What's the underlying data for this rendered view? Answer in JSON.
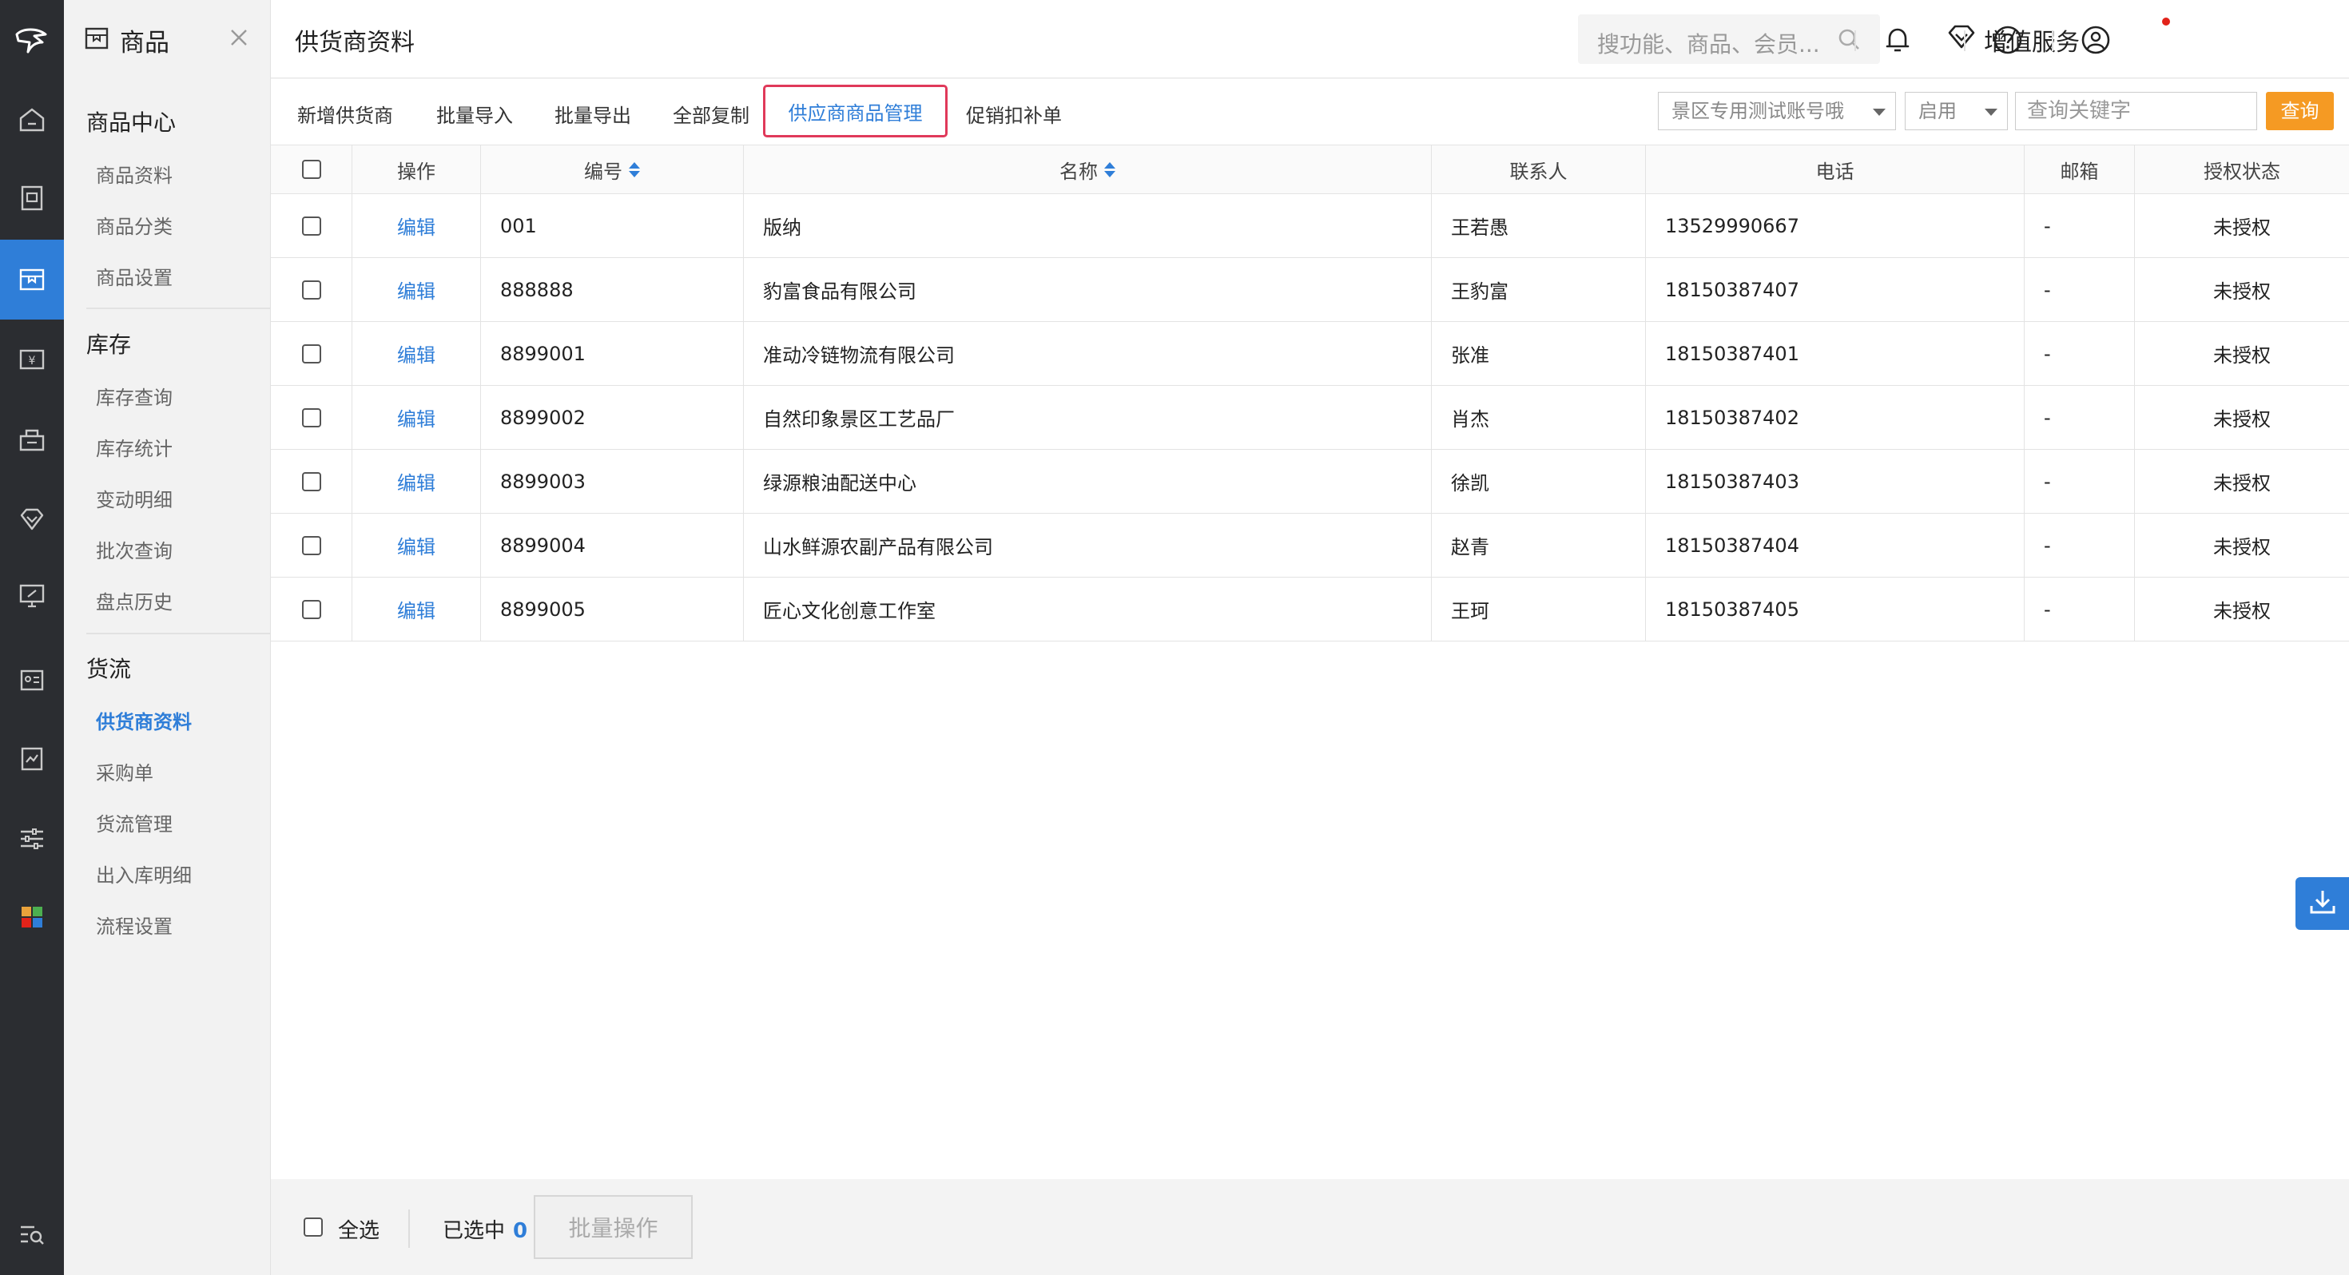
{
  "sidebar": {
    "module_title": "商品",
    "sections": [
      {
        "title": "商品中心",
        "items": [
          "商品资料",
          "商品分类",
          "商品设置"
        ]
      },
      {
        "title": "库存",
        "items": [
          "库存查询",
          "库存统计",
          "变动明细",
          "批次查询",
          "盘点历史"
        ]
      },
      {
        "title": "货流",
        "items": [
          "供货商资料",
          "采购单",
          "货流管理",
          "出入库明细",
          "流程设置"
        ]
      }
    ],
    "active_item": "供货商资料"
  },
  "rail": {
    "icons": [
      "logo-icon",
      "home-icon",
      "goods-list-icon",
      "goods-icon",
      "cashier-icon",
      "member-icon",
      "vip-icon",
      "promotion-icon",
      "staff-icon",
      "report-icon",
      "settings-icon",
      "apps-icon",
      "search-menu-icon"
    ],
    "active": "goods-icon"
  },
  "header": {
    "title": "供货商资料",
    "search_placeholder": "搜功能、商品、会员...",
    "value_added": "增值服务"
  },
  "toolbar": {
    "buttons": [
      "新增供货商",
      "批量导入",
      "批量导出",
      "全部复制",
      "供应商商品管理",
      "促销扣补单"
    ],
    "highlighted": "供应商商品管理",
    "store_select": "景区专用测试账号哦",
    "status_select": "启用",
    "keyword_placeholder": "查询关键字",
    "query_label": "查询"
  },
  "table": {
    "columns": [
      "",
      "操作",
      "编号",
      "名称",
      "联系人",
      "电话",
      "邮箱",
      "授权状态"
    ],
    "edit_label": "编辑",
    "rows": [
      {
        "code": "001",
        "name": "版纳",
        "contact": "王若愚",
        "phone": "13529990667",
        "email": "-",
        "status": "未授权"
      },
      {
        "code": "888888",
        "name": "豹富食品有限公司",
        "contact": "王豹富",
        "phone": "18150387407",
        "email": "-",
        "status": "未授权"
      },
      {
        "code": "8899001",
        "name": "准动冷链物流有限公司",
        "contact": "张准",
        "phone": "18150387401",
        "email": "-",
        "status": "未授权"
      },
      {
        "code": "8899002",
        "name": "自然印象景区工艺品厂",
        "contact": "肖杰",
        "phone": "18150387402",
        "email": "-",
        "status": "未授权"
      },
      {
        "code": "8899003",
        "name": "绿源粮油配送中心",
        "contact": "徐凯",
        "phone": "18150387403",
        "email": "-",
        "status": "未授权"
      },
      {
        "code": "8899004",
        "name": "山水鲜源农副产品有限公司",
        "contact": "赵青",
        "phone": "18150387404",
        "email": "-",
        "status": "未授权"
      },
      {
        "code": "8899005",
        "name": "匠心文化创意工作室",
        "contact": "王珂",
        "phone": "18150387405",
        "email": "-",
        "status": "未授权"
      }
    ]
  },
  "footer": {
    "select_all": "全选",
    "selected_label": "已选中",
    "selected_count": "0",
    "batch_label": "批量操作"
  }
}
